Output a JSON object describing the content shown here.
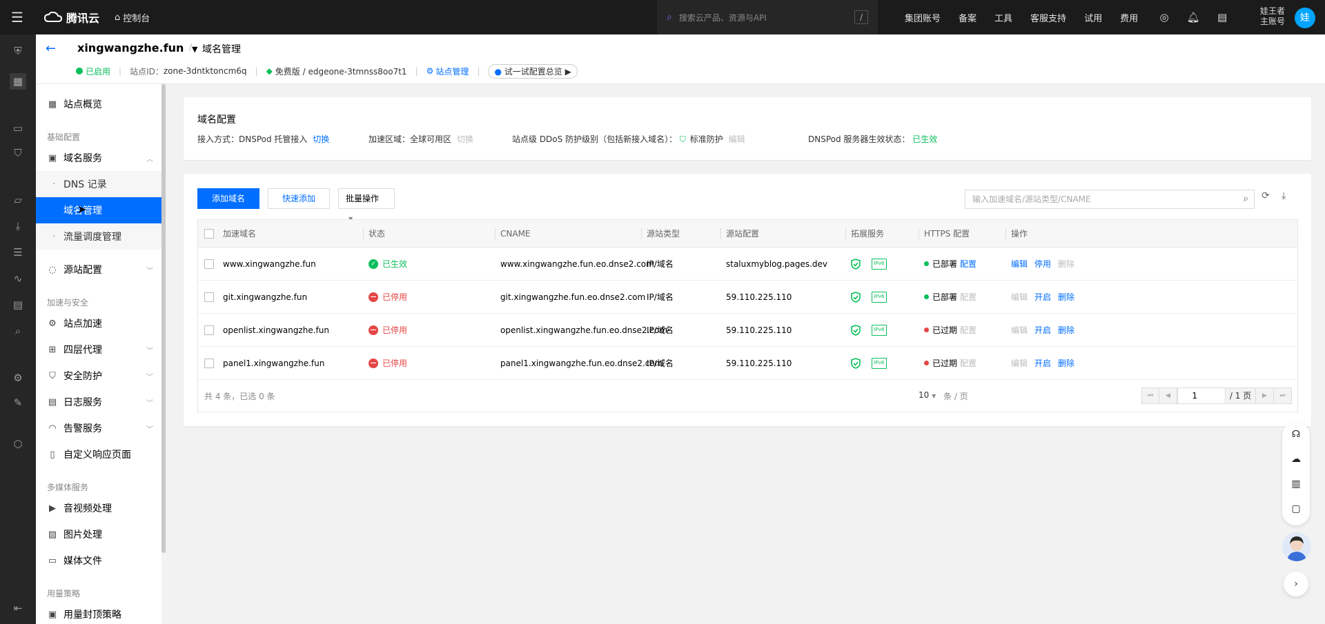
{
  "topbar": {
    "brand": "腾讯云",
    "console": "控制台",
    "search_placeholder": "搜索云产品、资源与API",
    "search_shortcut": "/",
    "nav": [
      "集团账号",
      "备案",
      "工具",
      "客服支持",
      "试用",
      "费用"
    ],
    "user_name": "娃王者",
    "user_role": "主账号",
    "avatar": "娃"
  },
  "header": {
    "site_name": "xingwangzhe.fun",
    "separator": "/",
    "page_title": "域名管理",
    "status": "已启用",
    "site_id_label": "站点ID：",
    "site_id": "zone-3dntktoncm6q",
    "plan": "免费版 / edgeone-3tmnss8oo7t1",
    "site_manage": "站点管理",
    "try_config": "试一试配置总览"
  },
  "sidebar": {
    "overview": "站点概览",
    "group_basic": "基础配置",
    "domain_service": "域名服务",
    "dns_records": "DNS 记录",
    "domain_manage": "域名管理",
    "traffic_schedule": "流量调度管理",
    "origin_config": "源站配置",
    "group_accel": "加速与安全",
    "site_accel": "站点加速",
    "l4_proxy": "四层代理",
    "security": "安全防护",
    "log_service": "日志服务",
    "alert_service": "告警服务",
    "custom_page": "自定义响应页面",
    "group_media": "多媒体服务",
    "av_process": "音视频处理",
    "image_process": "图片处理",
    "media_files": "媒体文件",
    "group_usage": "用量策略",
    "usage_cap": "用量封顶策略"
  },
  "domain_config": {
    "title": "域名配置",
    "access_label": "接入方式：DNSPod 托管接入",
    "access_switch": "切换",
    "region_label": "加速区域：全球可用区",
    "region_switch": "切换",
    "ddos_label": "站点级 DDoS 防护级别（包括新接入域名）：",
    "ddos_value": "标准防护",
    "ddos_edit": "编辑",
    "dnspod_label": "DNSPod 服务器生效状态：",
    "dnspod_value": "已生效"
  },
  "toolbar": {
    "add_domain": "添加域名",
    "quick_add": "快速添加",
    "batch": "批量操作",
    "search_placeholder": "输入加速域名/源站类型/CNAME"
  },
  "table": {
    "headers": [
      "加速域名",
      "状态",
      "CNAME",
      "源站类型",
      "源站配置",
      "拓展服务",
      "HTTPS 配置",
      "操作"
    ],
    "ipv6_label": "IPv6",
    "rows": [
      {
        "domain": "www.xingwangzhe.fun",
        "status": "已生效",
        "cname": "www.xingwangzhe.fun.eo.dnse2.com",
        "origin_type": "IP/域名",
        "origin": "staluxmyblog.pages.dev",
        "https": "已部署",
        "https_action": "配置",
        "op1": "编辑",
        "op2": "停用",
        "op3": "删除"
      },
      {
        "domain": "git.xingwangzhe.fun",
        "status": "已停用",
        "cname": "git.xingwangzhe.fun.eo.dnse2.com",
        "origin_type": "IP/域名",
        "origin": "59.110.225.110",
        "https": "已部署",
        "https_action": "配置",
        "op1": "编辑",
        "op2": "开启",
        "op3": "删除"
      },
      {
        "domain": "openlist.xingwangzhe.fun",
        "status": "已停用",
        "cname": "openlist.xingwangzhe.fun.eo.dnse2.com",
        "origin_type": "IP/域名",
        "origin": "59.110.225.110",
        "https": "已过期",
        "https_action": "配置",
        "op1": "编辑",
        "op2": "开启",
        "op3": "删除"
      },
      {
        "domain": "panel1.xingwangzhe.fun",
        "status": "已停用",
        "cname": "panel1.xingwangzhe.fun.eo.dnse2.com",
        "origin_type": "IP/域名",
        "origin": "59.110.225.110",
        "https": "已过期",
        "https_action": "配置",
        "op1": "编辑",
        "op2": "开启",
        "op3": "删除"
      }
    ],
    "summary": "共 4 条，已选 0 条",
    "page_size": "10",
    "page_size_unit": "条 / 页",
    "current_page": "1",
    "total_pages": "/ 1 页"
  },
  "colors": {
    "accent": "#006eff",
    "success": "#0abf5b",
    "danger": "#e54545",
    "topbar": "#1b1b1b"
  }
}
